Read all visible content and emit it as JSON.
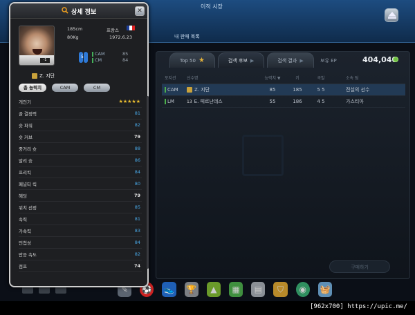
{
  "app": {
    "top_title": "이적 시장",
    "sub_title": "내 판매 목록",
    "tabs": [
      {
        "label": "Top 50",
        "icon": "star-icon"
      },
      {
        "label": "검색 후보",
        "icon": "arrow-icon"
      },
      {
        "label": "검색 결과",
        "icon": "arrow-icon"
      }
    ],
    "ep_label": "보유 EP",
    "ep_value": "404,040",
    "table": {
      "headers": [
        "포지션",
        "선수명",
        "능력치 ▼",
        "키",
        "곡발",
        "소속 팀"
      ],
      "rows": [
        {
          "pos": "CAM",
          "name": "Z. 지단",
          "rating": "85",
          "height": "185",
          "foot": "5 5",
          "team": "전설의 선수"
        },
        {
          "pos": "LM",
          "num": "13",
          "name": "E. 페르난데스",
          "rating": "55",
          "height": "186",
          "foot": "4 5",
          "team": "가스티아"
        }
      ]
    },
    "buy_button": "구매하기"
  },
  "popup": {
    "title": "상세 정보",
    "close": "✕",
    "height": "185cm",
    "weight": "80Kg",
    "country": "프랑스",
    "birth": "1972.6.23",
    "boots_number": "5",
    "positions": [
      {
        "label": "CAM",
        "value": "85"
      },
      {
        "label": "CM",
        "value": "84"
      }
    ],
    "jersey_tag": "-1",
    "player_name": "Z. 지단",
    "stat_tabs": [
      "총 능력치",
      "CAM",
      "CM"
    ],
    "stats": [
      {
        "label": "개인기",
        "value": "★★★★★",
        "style": "stars"
      },
      {
        "label": "골 결정력",
        "value": "81",
        "style": "blue"
      },
      {
        "label": "슛 파워",
        "value": "82",
        "style": "blue"
      },
      {
        "label": "슛 커브",
        "value": "79",
        "style": "white"
      },
      {
        "label": "중거리 슛",
        "value": "88",
        "style": "blue"
      },
      {
        "label": "발리 슛",
        "value": "86",
        "style": "blue"
      },
      {
        "label": "프리킥",
        "value": "84",
        "style": "blue"
      },
      {
        "label": "페널티 킥",
        "value": "80",
        "style": "blue"
      },
      {
        "label": "헤딩",
        "value": "79",
        "style": "white"
      },
      {
        "label": "위치 선정",
        "value": "85",
        "style": "blue"
      },
      {
        "label": "속력",
        "value": "81",
        "style": "blue"
      },
      {
        "label": "가속력",
        "value": "83",
        "style": "blue"
      },
      {
        "label": "민첩성",
        "value": "84",
        "style": "blue"
      },
      {
        "label": "반응 속도",
        "value": "82",
        "style": "blue"
      },
      {
        "label": "점프",
        "value": "74",
        "style": "white"
      }
    ]
  },
  "dock_icons": [
    "pen-icon",
    "soccer-ball-icon",
    "boot-icon",
    "trophy-icon",
    "cone-icon",
    "field-icon",
    "cards-icon",
    "shield-icon",
    "club-icon",
    "basket-icon"
  ],
  "footer": "[962x700] https://upic.me/",
  "colors": {
    "stat_blue": "#49a9e8",
    "accent": "#1d4c80",
    "star": "#f0c230"
  }
}
